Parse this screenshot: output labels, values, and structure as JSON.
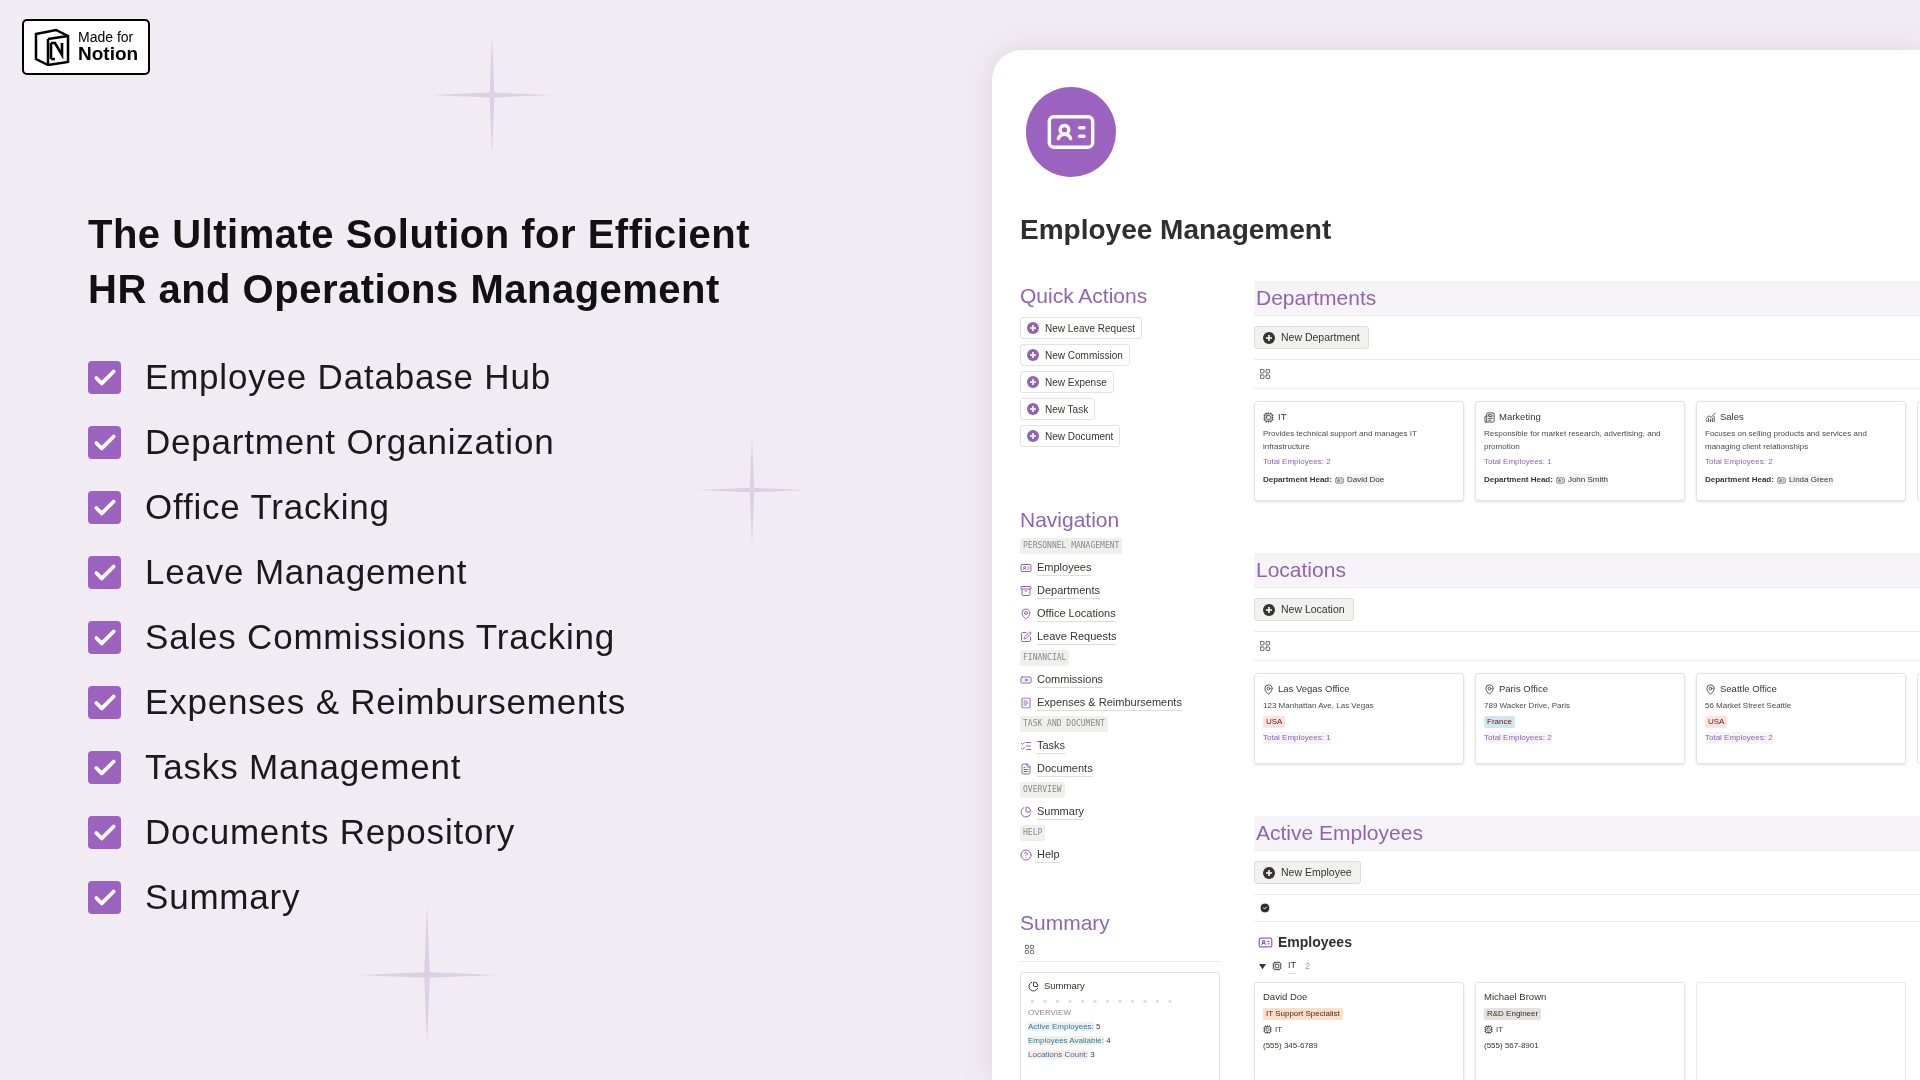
{
  "badge": {
    "line1": "Made for",
    "line2": "Notion"
  },
  "headline": "The Ultimate Solution for Efficient HR and Operations Management",
  "features": [
    {
      "label": "Employee Database Hub",
      "checked": true
    },
    {
      "label": "Department Organization",
      "checked": true
    },
    {
      "label": "Office Tracking",
      "checked": true
    },
    {
      "label": "Leave Management",
      "checked": true
    },
    {
      "label": "Sales Commissions Tracking",
      "checked": true
    },
    {
      "label": "Expenses & Reimbursements",
      "checked": true
    },
    {
      "label": "Tasks Management",
      "checked": true
    },
    {
      "label": "Documents Repository",
      "checked": true
    },
    {
      "label": "Summary",
      "checked": true
    }
  ],
  "page": {
    "title": "Employee Management",
    "quick_actions": {
      "title": "Quick Actions",
      "buttons": [
        "New Leave Request",
        "New Commission",
        "New Expense",
        "New Task",
        "New Document"
      ]
    },
    "navigation": {
      "title": "Navigation",
      "groups": [
        {
          "label": "PERSONNEL MANAGEMENT",
          "items": [
            "Employees",
            "Departments",
            "Office Locations",
            "Leave Requests"
          ]
        },
        {
          "label": "FINANCIAL",
          "items": [
            "Commissions",
            "Expenses & Reimbursements"
          ]
        },
        {
          "label": "TASK AND DOCUMENT",
          "items": [
            "Tasks",
            "Documents"
          ]
        },
        {
          "label": "OVERVIEW",
          "items": [
            "Summary"
          ]
        },
        {
          "label": "HELP",
          "items": [
            "Help"
          ]
        }
      ]
    },
    "summary": {
      "title": "Summary",
      "card_title": "Summary",
      "section": "OVERVIEW",
      "stats": [
        {
          "label": "Active Employees:",
          "value": "5",
          "color": "#e7f3f8"
        },
        {
          "label": "Employees Available:",
          "value": "4",
          "color": "#edf3ec"
        },
        {
          "label": "Locations Count:",
          "value": "3",
          "color": "#faecec"
        }
      ]
    },
    "departments": {
      "title": "Departments",
      "button": "New Department",
      "cards": [
        {
          "name": "IT",
          "description": "Provides technical support and manages IT infrastructure",
          "total": "Total Employees: 2",
          "head_label": "Department Head:",
          "head": "David Doe"
        },
        {
          "name": "Marketing",
          "description": "Responsible for market research, advertising, and promotion",
          "total": "Total Employees: 1",
          "head_label": "Department Head:",
          "head": "John Smith"
        },
        {
          "name": "Sales",
          "description": "Focuses on selling products and services and managing client relationships",
          "total": "Total Employees: 2",
          "head_label": "Department Head:",
          "head": "Linda Green"
        }
      ]
    },
    "locations": {
      "title": "Locations",
      "button": "New Location",
      "cards": [
        {
          "name": "Las Vegas Office",
          "address": "123 Manhattan Ave, Las Vegas",
          "country": "USA",
          "color": "#ffe2dd",
          "total": "Total Employees: 1"
        },
        {
          "name": "Paris Office",
          "address": "789 Wacker Drive, Paris",
          "country": "France",
          "color": "#d3e5ef",
          "total": "Total Employees: 2"
        },
        {
          "name": "Seattle Office",
          "address": "56 Market Street Seattle",
          "country": "USA",
          "color": "#ffe2dd",
          "total": "Total Employees: 2"
        }
      ]
    },
    "employees": {
      "title": "Active Employees",
      "button": "New Employee",
      "view_title": "Employees",
      "group": {
        "name": "IT",
        "count": "2",
        "expanded": true
      },
      "cards": [
        {
          "name": "David Doe",
          "role": "IT Support Specialist",
          "color": "#fadec9",
          "department": "IT",
          "phone": "(555) 345-6789"
        },
        {
          "name": "Michael Brown",
          "role": "R&D Engineer",
          "color": "#e3e2e0",
          "department": "IT",
          "phone": "(555) 567-8901"
        }
      ]
    }
  }
}
